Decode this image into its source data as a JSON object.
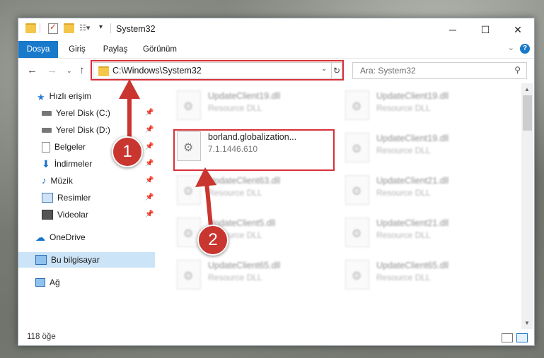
{
  "window": {
    "title": "System32",
    "controls": {
      "minimize": "─",
      "maximize": "☐",
      "close": "✕"
    }
  },
  "ribbon": {
    "tabs": [
      {
        "label": "Dosya",
        "active": true
      },
      {
        "label": "Giriş"
      },
      {
        "label": "Paylaş"
      },
      {
        "label": "Görünüm"
      }
    ],
    "help": "?"
  },
  "address": {
    "path": "C:\\Windows\\System32",
    "search_placeholder": "Ara: System32"
  },
  "sidebar": {
    "quick_access": "Hızlı erişim",
    "items": [
      {
        "label": "Yerel Disk (C:)",
        "icon": "drive-icon",
        "pinned": true
      },
      {
        "label": "Yerel Disk (D:)",
        "icon": "drive-icon",
        "pinned": true
      },
      {
        "label": "Belgeler",
        "icon": "documents-icon",
        "pinned": true
      },
      {
        "label": "İndirmeler",
        "icon": "downloads-icon",
        "pinned": true
      },
      {
        "label": "Müzik",
        "icon": "music-icon",
        "pinned": true
      },
      {
        "label": "Resimler",
        "icon": "pictures-icon",
        "pinned": true
      },
      {
        "label": "Videolar",
        "icon": "videos-icon",
        "pinned": true
      }
    ],
    "onedrive": "OneDrive",
    "this_pc": "Bu bilgisayar",
    "network": "Ağ"
  },
  "files": [
    {
      "name": "UpdateClient19.dll",
      "desc": "Resource DLL"
    },
    {
      "name": "UpdateClient19.dll",
      "desc": "Resource DLL"
    },
    {
      "name": "borland.globalization...",
      "desc": "7.1.1446.610"
    },
    {
      "name": "UpdateClient19.dll",
      "desc": "Resource DLL"
    },
    {
      "name": "UpdateClient63.dll",
      "desc": "Resource DLL"
    },
    {
      "name": "UpdateClient21.dll",
      "desc": "Resource DLL"
    },
    {
      "name": "UpdateClient5.dll",
      "desc": "Resource DLL"
    },
    {
      "name": "UpdateClient21.dll",
      "desc": "Resource DLL"
    },
    {
      "name": "UpdateClient65.dll",
      "desc": "Resource DLL"
    },
    {
      "name": "UpdateClient65.dll",
      "desc": "Resource DLL"
    }
  ],
  "status": {
    "count": "118 öğe"
  },
  "annotations": {
    "badge1": "1",
    "badge2": "2"
  },
  "colors": {
    "accent": "#1979ca",
    "highlight": "#d9303a",
    "selected": "#cce4f7"
  }
}
